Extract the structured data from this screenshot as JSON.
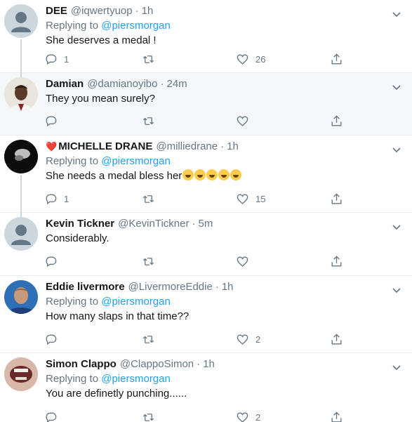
{
  "tweets": [
    {
      "name": "DEE",
      "handle": "@iqwertyuop",
      "sep": "·",
      "time": "1h",
      "replying_label": "Replying to",
      "replying_to": "@piersmorgan",
      "text": "She deserves a medal !",
      "replies": "1",
      "retweets": "",
      "likes": "26"
    },
    {
      "name": "Damian",
      "handle": "@damianoyibo",
      "sep": "·",
      "time": "24m",
      "text": "They you mean surely?",
      "replies": "",
      "retweets": "",
      "likes": ""
    },
    {
      "name_emoji": "❤️",
      "name": "MICHELLE DRANE",
      "handle": "@milliedrane",
      "sep": "·",
      "time": "1h",
      "replying_label": "Replying to",
      "replying_to": "@piersmorgan",
      "text": "She needs a medal bless her",
      "text_emoji": "🤣🤣🤣🤣🤣",
      "replies": "1",
      "retweets": "",
      "likes": "15"
    },
    {
      "name": "Kevin Tickner",
      "handle": "@KevinTickner",
      "sep": "·",
      "time": "5m",
      "text": "Considerably.",
      "replies": "",
      "retweets": "",
      "likes": ""
    },
    {
      "name": "Eddie livermore",
      "handle": "@LivermoreEddie",
      "sep": "·",
      "time": "1h",
      "replying_label": "Replying to",
      "replying_to": "@piersmorgan",
      "text": "How many slaps in that time??",
      "replies": "",
      "retweets": "",
      "likes": "2"
    },
    {
      "name": "Simon Clappo",
      "handle": "@ClappoSimon",
      "sep": "·",
      "time": "1h",
      "replying_label": "Replying to",
      "replying_to": "@piersmorgan",
      "text": "You are definetly punching......",
      "replies": "",
      "retweets": "",
      "likes": "2"
    }
  ],
  "colors": {
    "accent": "#1da1f2",
    "muted": "#657786",
    "highlight_bg": "#f5f8fa",
    "divider": "#e6ecf0"
  },
  "icons": {
    "reply": "reply-icon",
    "retweet": "retweet-icon",
    "like": "heart-icon",
    "share": "share-icon",
    "menu": "chevron-down-icon"
  }
}
